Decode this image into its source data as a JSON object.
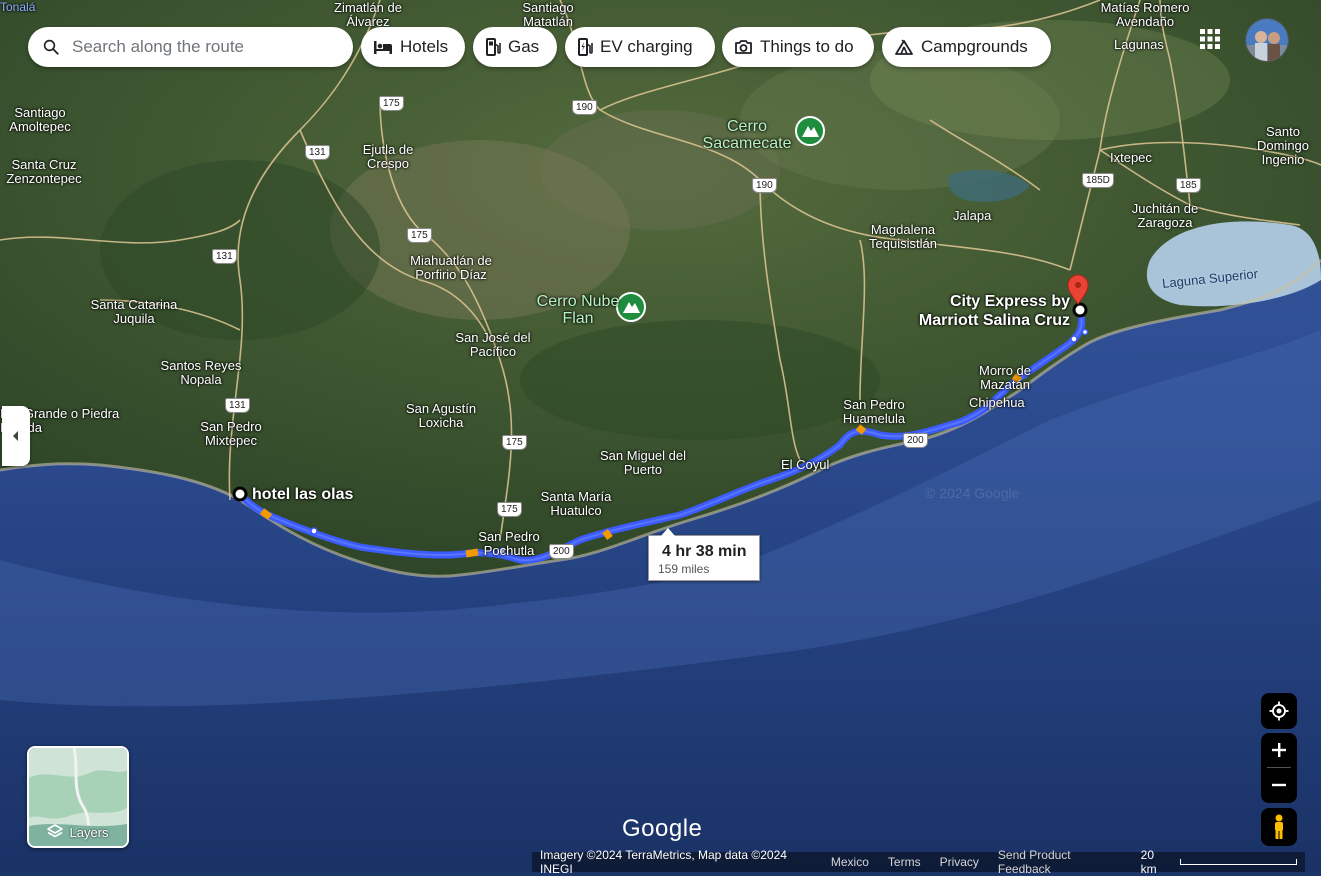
{
  "search": {
    "placeholder": "Search along the route"
  },
  "chips": [
    {
      "label": "Hotels",
      "icon": "hotel-bed-icon"
    },
    {
      "label": "Gas",
      "icon": "gas-pump-icon"
    },
    {
      "label": "EV charging",
      "icon": "ev-charger-icon"
    },
    {
      "label": "Things to do",
      "icon": "camera-icon"
    },
    {
      "label": "Campgrounds",
      "icon": "tent-icon"
    }
  ],
  "route": {
    "origin": "hotel las olas",
    "destination": "City Express by Marriott Salina Cruz",
    "duration": "4 hr 38 min",
    "distance": "159 miles",
    "color": "#3b5bfc"
  },
  "places": [
    "Zimatlán de Álvarez",
    "Santiago Matatlán",
    "Matías Romero Avendaño",
    "Lagunas",
    "Santiago Amoltepec",
    "Santa Cruz Zenzontepec",
    "Ejutla de Crespo",
    "Ixtepec",
    "Santo Domingo Ingenio",
    "Juchitán de Zaragoza",
    "Jalapa",
    "Magdalena Tequisistlán",
    "Miahuatlán de Porfirio Díaz",
    "Santa Catarina Juquila",
    "San José del Pacífico",
    "Santos Reyes Nopala",
    "San Pedro Mixtepec",
    "Río Grande o Piedra Parada",
    "San Agustín Loxicha",
    "San Miguel del Puerto",
    "Santa María Huatulco",
    "San Pedro Pochutla",
    "El Coyul",
    "San Pedro Huamelula",
    "Morro de Mazatán",
    "Chipehua",
    "Laguna Superior",
    "Tonalá"
  ],
  "parks": [
    "Cerro Sacamecate",
    "Cerro Nube Flan"
  ],
  "highways": [
    "131",
    "175",
    "190",
    "185D",
    "185",
    "200"
  ],
  "layers_label": "Layers",
  "logo": "Google",
  "footer": {
    "attribution": "Imagery ©2024 TerraMetrics, Map data ©2024 INEGI",
    "country": "Mexico",
    "terms": "Terms",
    "privacy": "Privacy",
    "feedback": "Send Product Feedback",
    "scale": "20 km"
  },
  "watermark": "© 2024 Google"
}
